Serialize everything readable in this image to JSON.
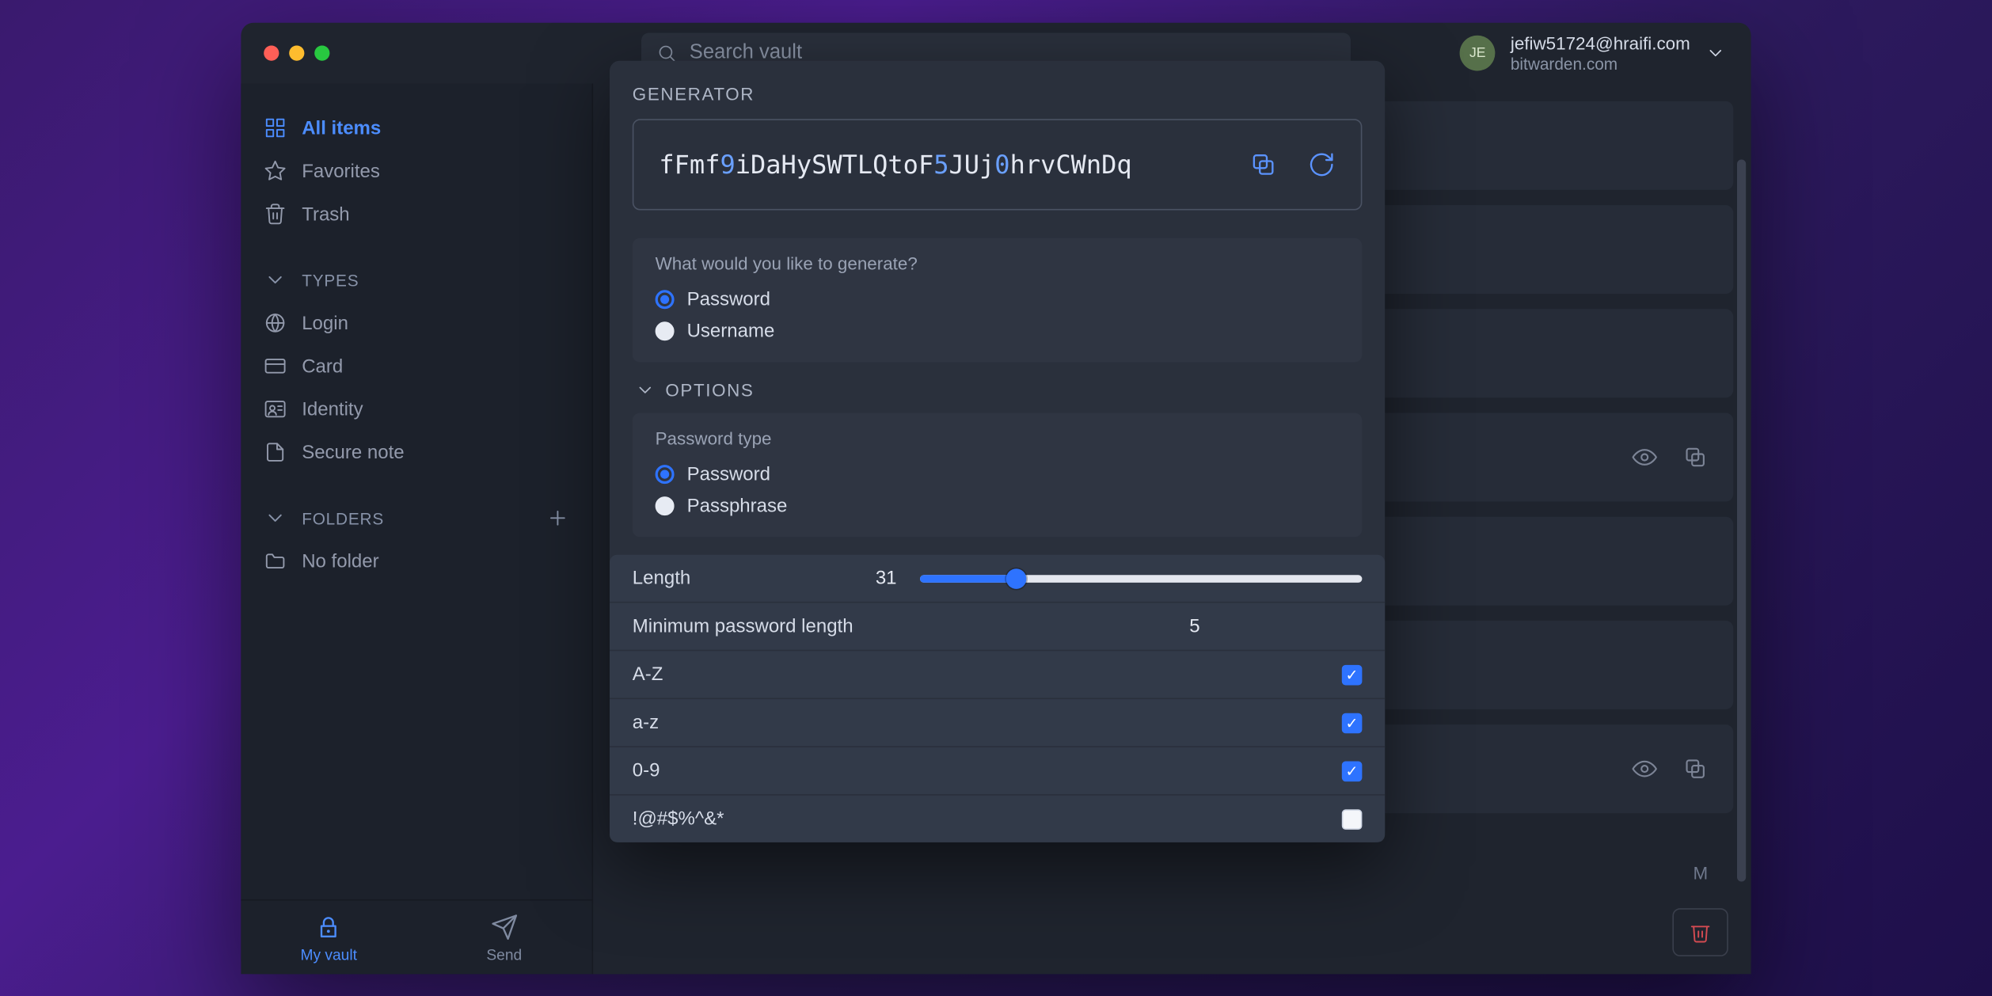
{
  "header": {
    "search_placeholder": "Search vault",
    "account": {
      "initials": "JE",
      "email": "jefiw51724@hraifi.com",
      "domain": "bitwarden.com"
    }
  },
  "sidebar": {
    "main": [
      {
        "id": "all",
        "label": "All items",
        "active": true
      },
      {
        "id": "fav",
        "label": "Favorites",
        "active": false
      },
      {
        "id": "trash",
        "label": "Trash",
        "active": false
      }
    ],
    "types_header": "Types",
    "types": [
      {
        "id": "login",
        "label": "Login"
      },
      {
        "id": "card",
        "label": "Card"
      },
      {
        "id": "identity",
        "label": "Identity"
      },
      {
        "id": "note",
        "label": "Secure note"
      }
    ],
    "folders_header": "Folders",
    "folders": [
      {
        "id": "none",
        "label": "No folder"
      }
    ],
    "tabs": {
      "vault": "My vault",
      "send": "Send"
    }
  },
  "content": {
    "timestamp_hint": "M"
  },
  "generator": {
    "title": "GENERATOR",
    "password_parts": [
      {
        "t": "fFmf",
        "k": "a"
      },
      {
        "t": "9",
        "k": "n"
      },
      {
        "t": "iDaHySWTLQtoF",
        "k": "a"
      },
      {
        "t": "5",
        "k": "n"
      },
      {
        "t": "JUj",
        "k": "a"
      },
      {
        "t": "0",
        "k": "n"
      },
      {
        "t": "hrvCWnDq",
        "k": "a"
      }
    ],
    "generate_question": "What would you like to generate?",
    "generate_options": [
      {
        "id": "password",
        "label": "Password",
        "selected": true
      },
      {
        "id": "username",
        "label": "Username",
        "selected": false
      }
    ],
    "options_header": "OPTIONS",
    "password_type_label": "Password type",
    "password_type_options": [
      {
        "id": "pw",
        "label": "Password",
        "selected": true
      },
      {
        "id": "pp",
        "label": "Passphrase",
        "selected": false
      }
    ],
    "length_label": "Length",
    "length_value": "31",
    "min_length_label": "Minimum password length",
    "min_length_value": "5",
    "charsets": [
      {
        "id": "upper",
        "label": "A-Z",
        "checked": true
      },
      {
        "id": "lower",
        "label": "a-z",
        "checked": true
      },
      {
        "id": "digits",
        "label": "0-9",
        "checked": true
      },
      {
        "id": "sym",
        "label": "!@#$%^&*",
        "checked": false
      }
    ]
  }
}
